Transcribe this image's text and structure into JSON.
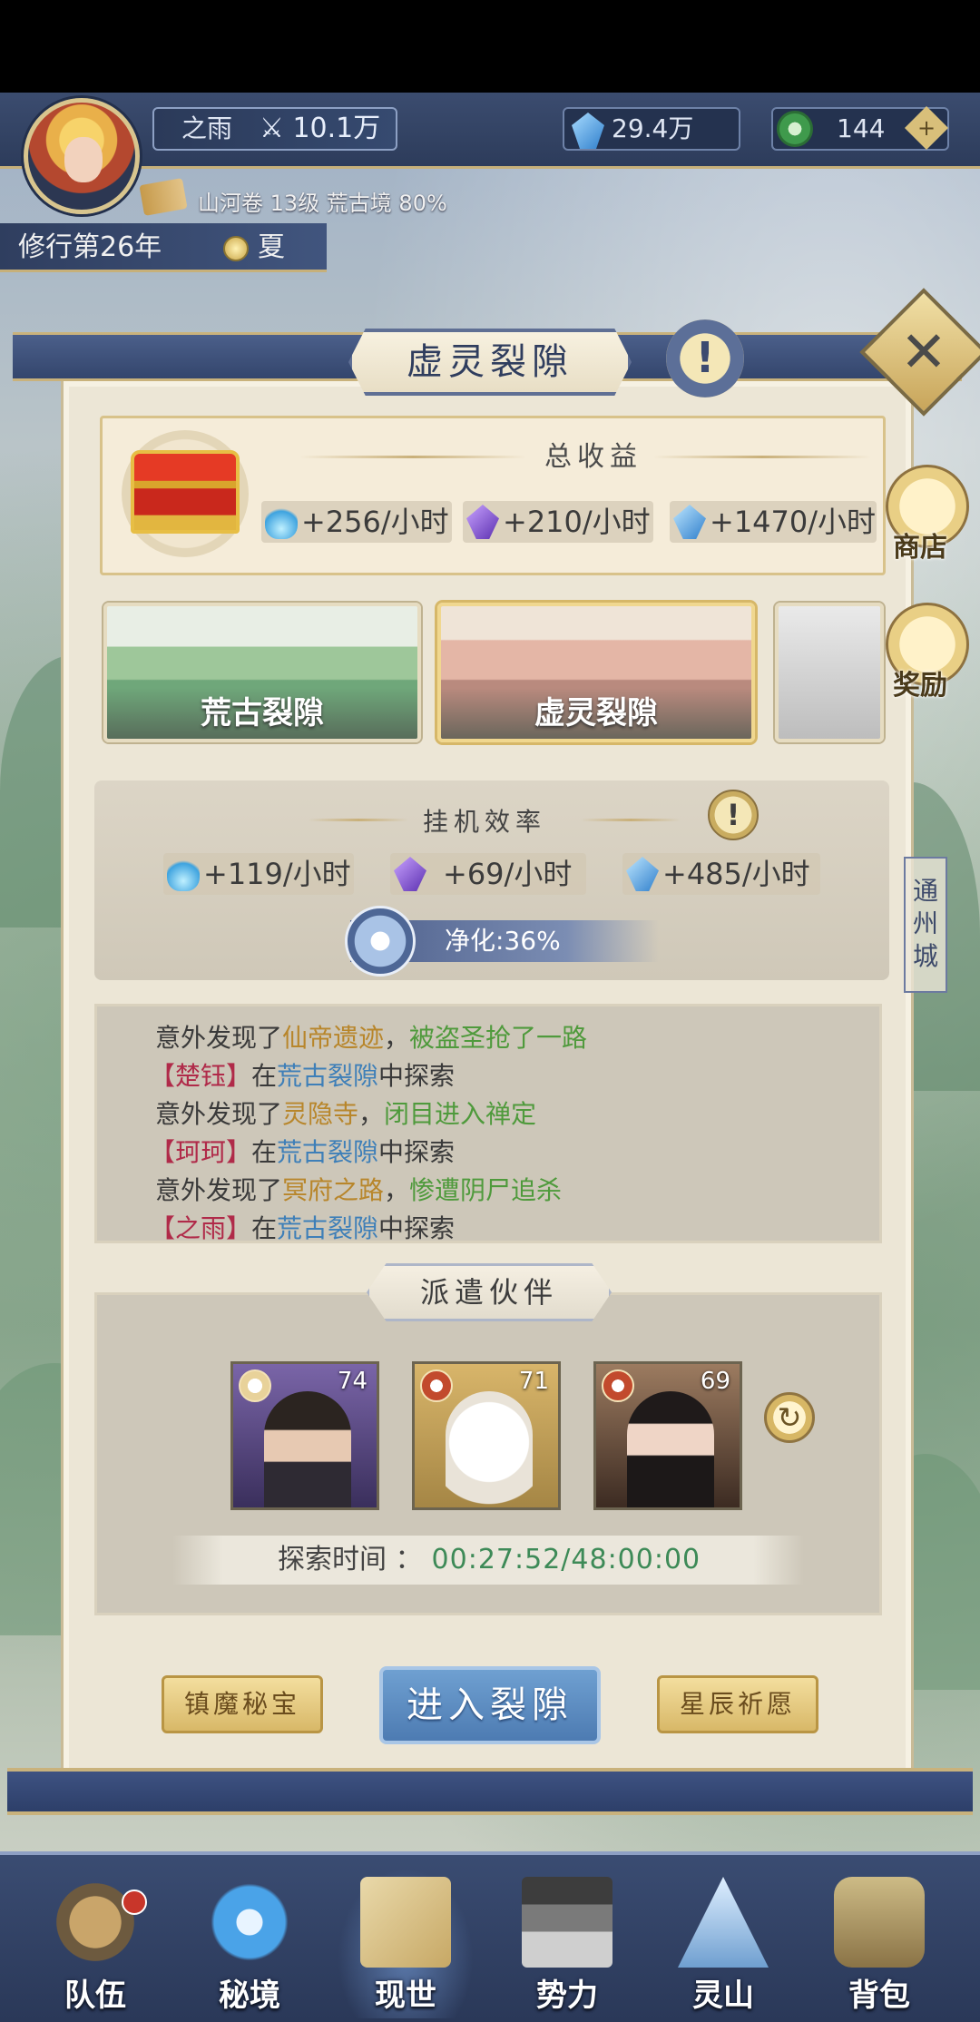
{
  "hud": {
    "player_name": "之雨",
    "power": "10.1万",
    "crystal_amount": "29.4万",
    "jade_amount": "144",
    "rank_text": "山河卷 13级 荒古境 80%",
    "year_text": "修行第26年",
    "season": "夏"
  },
  "panel": {
    "title": "虚灵裂隙",
    "close_label": "✕",
    "info_label": "!"
  },
  "income": {
    "title": "总收益",
    "rates": [
      "+256/小时",
      "+210/小时",
      "+1470/小时"
    ]
  },
  "side_buttons": {
    "shop": "商店",
    "reward": "奖励"
  },
  "rifts": [
    {
      "label": "荒古裂隙"
    },
    {
      "label": "虚灵裂隙"
    }
  ],
  "efficiency": {
    "title": "挂机效率",
    "rates": [
      "+119/小时",
      "+69/小时",
      "+485/小时"
    ],
    "purify": "净化:36%"
  },
  "log": [
    {
      "prefix": "意外发现了",
      "place": "仙帝遗迹",
      "sep": "，",
      "result": "被盗圣抢了一路"
    },
    {
      "name": "【楚钰】",
      "mid": "在",
      "rift": "荒古裂隙",
      "suffix": "中探索"
    },
    {
      "prefix": "意外发现了",
      "place": "灵隐寺",
      "sep": "，",
      "result": "闭目进入禅定"
    },
    {
      "name": "【珂珂】",
      "mid": "在",
      "rift": "荒古裂隙",
      "suffix": "中探索"
    },
    {
      "prefix": "意外发现了",
      "place": "冥府之路",
      "sep": "，",
      "result": "惨遭阴尸追杀"
    },
    {
      "name": "【之雨】",
      "mid": "在",
      "rift": "荒古裂隙",
      "suffix": "中探索"
    }
  ],
  "dispatch": {
    "title": "派遣伙伴",
    "partners": [
      {
        "level": "74"
      },
      {
        "level": "71"
      },
      {
        "level": "69"
      }
    ],
    "time_label": "探索时间 ：",
    "time_value": "00:27:52/48:00:00"
  },
  "buttons": {
    "treasure": "镇魔秘宝",
    "enter": "进入裂隙",
    "wish": "星辰祈愿"
  },
  "city_sign": "通州城",
  "nav": [
    "队伍",
    "秘境",
    "现世",
    "势力",
    "灵山",
    "背包"
  ],
  "colors": {
    "accent_blue": "#3e7fb8",
    "gold": "#b8862b",
    "green": "#4f9a3c",
    "name_red": "#b02a49"
  }
}
